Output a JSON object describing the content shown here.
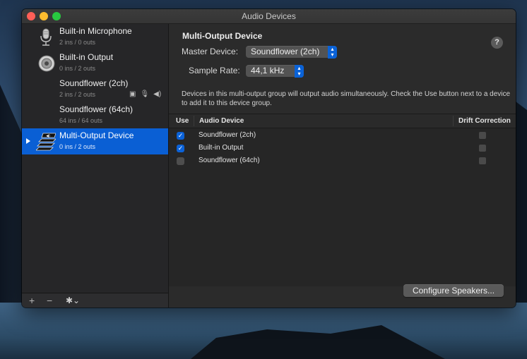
{
  "window": {
    "title": "Audio Devices"
  },
  "devices": [
    {
      "name": "Built-in Microphone",
      "sub": "2 ins / 0 outs",
      "icon": "microphone-icon"
    },
    {
      "name": "Built-in Output",
      "sub": "0 ins / 2 outs",
      "icon": "speaker-icon"
    },
    {
      "name": "Soundflower (2ch)",
      "sub": "2 ins / 2 outs",
      "icon": ""
    },
    {
      "name": "Soundflower (64ch)",
      "sub": "64 ins / 64 outs",
      "icon": ""
    },
    {
      "name": "Multi-Output Device",
      "sub": "0 ins / 2 outs",
      "icon": "multi-output-icon",
      "selected": true
    }
  ],
  "sidebar_toolbar": {
    "add": "+",
    "remove": "−",
    "gear": "✱⌄"
  },
  "detail": {
    "title": "Multi-Output Device",
    "master_label": "Master Device:",
    "master_value": "Soundflower (2ch)",
    "rate_label": "Sample Rate:",
    "rate_value": "44,1 kHz",
    "help": "?",
    "description": "Devices in this multi-output group will output audio simultaneously. Check the Use button next to a device to add it to this device group."
  },
  "table": {
    "headers": {
      "use": "Use",
      "device": "Audio Device",
      "drift": "Drift Correction"
    },
    "rows": [
      {
        "device": "Soundflower (2ch)",
        "use": true,
        "drift": false
      },
      {
        "device": "Built-in Output",
        "use": true,
        "drift": false
      },
      {
        "device": "Soundflower (64ch)",
        "use": false,
        "drift": false
      }
    ]
  },
  "buttons": {
    "configure": "Configure Speakers..."
  },
  "colors": {
    "accent": "#0a5fd4",
    "close": "#ff5f57",
    "minimize": "#febc2e",
    "zoom": "#28c840"
  }
}
